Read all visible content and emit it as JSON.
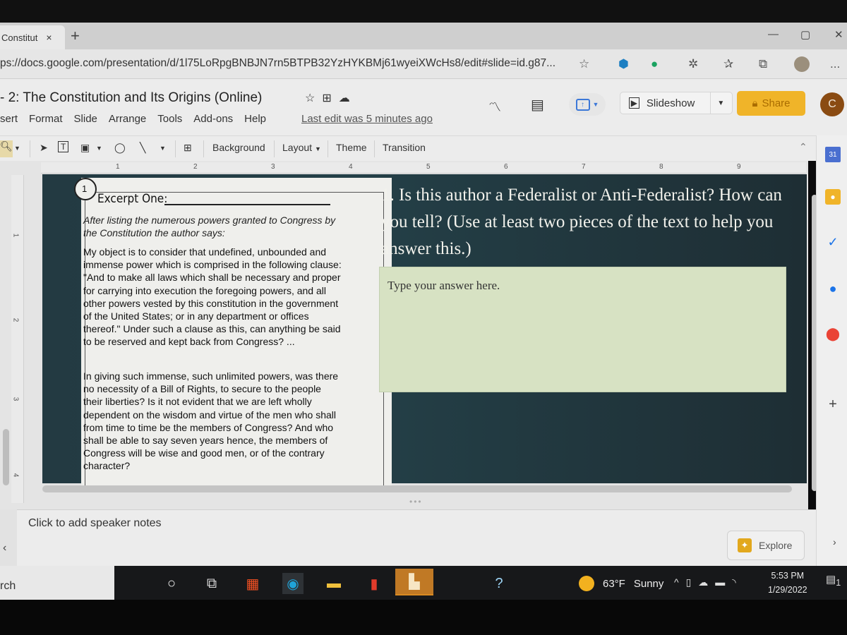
{
  "browser": {
    "tab_title": "Constitut",
    "tab_close": "×",
    "new_tab": "+",
    "url": "ps://docs.google.com/presentation/d/1l75LoRpgBNBJN7rn5BTPB32YzHYKBMj61wyeiXWcHs8/edit#slide=id.g87...",
    "window_controls": {
      "minimize": "—",
      "maximize": "▢",
      "close": "✕"
    },
    "more": "..."
  },
  "docs": {
    "title": "2: The Constitution and Its Origins (Online)",
    "title_prefix": "-",
    "menu": [
      "sert",
      "Format",
      "Slide",
      "Arrange",
      "Tools",
      "Add-ons",
      "Help"
    ],
    "last_edit": "Last edit was 5 minutes ago",
    "slideshow_label": "Slideshow",
    "share_label": "Share",
    "avatar_letter": "C"
  },
  "toolbar": {
    "background": "Background",
    "layout": "Layout",
    "theme": "Theme",
    "transition": "Transition"
  },
  "ruler": {
    "horizontal": [
      "1",
      "2",
      "3",
      "4",
      "5",
      "6",
      "7",
      "8",
      "9"
    ],
    "vertical": [
      "1",
      "2",
      "3",
      "4"
    ]
  },
  "slide": {
    "number": "1",
    "excerpt_title": "Excerpt One:",
    "excerpt_intro": "After listing the numerous powers granted to Congress by the Constitution the author says:",
    "paragraph1": "My object is to consider that undefined, unbounded and immense power which is comprised in the following clause: \"And to make all laws which shall be necessary and proper for carrying into execution the foregoing powers, and all other powers vested by this constitution in the government of the United States; or in any department or offices thereof.\" Under such a clause as this, can anything be said to be reserved and kept back from Congress? ...",
    "paragraph2": "In giving such immense, such unlimited powers, was there no necessity of a Bill of Rights, to secure to the people their liberties? Is it not evident that we are left wholly dependent on the wisdom and virtue of the men who shall from time to time be the members of Congress? And who shall be able to say seven years hence, the members of Congress will be wise and good men, or of the contrary character?",
    "question": "1. Is this author a Federalist or Anti-Federalist? How can you tell? (Use at least two pieces of the text to help you answer this.)",
    "answer_placeholder": "Type your answer here."
  },
  "notes": {
    "placeholder": "Click to add speaker notes"
  },
  "explore": {
    "label": "Explore"
  },
  "taskbar": {
    "search": "rch",
    "weather_temp": "63°F",
    "weather_desc": "Sunny",
    "time": "5:53 PM",
    "date": "1/29/2022",
    "notification_count": "1"
  },
  "colors": {
    "share": "#f0b429",
    "slide_bg": "#233a42",
    "answer_box": "#d7e2c3",
    "avatar": "#8a4b12"
  }
}
